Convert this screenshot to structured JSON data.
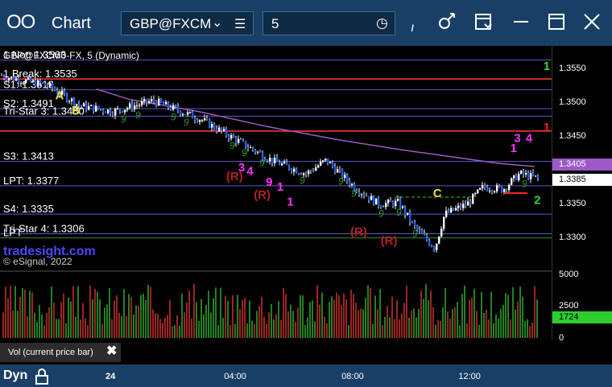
{
  "window": {
    "title": "Chart",
    "symbol": "GBP@FXCM",
    "interval": "5",
    "draw_tool_glyph": "ı"
  },
  "chart_data": {
    "type": "candlestick",
    "symbol_label": "GBP@FXCM0-FX, 5 (Dynamic)",
    "watermark": "tradesight.com",
    "copyright": "© eSignal, 2022",
    "price_axis": {
      "range": [
        1.3265,
        1.3578
      ],
      "ticks": [
        "1.3550",
        "1.3500",
        "1.3450",
        "1.3350",
        "1.3300"
      ],
      "last_price": "1.3385",
      "ma_value": "1.3405",
      "last_price_color": "#ffffff",
      "ma_color": "#9b59c9"
    },
    "time_axis": {
      "labels": [
        {
          "text": "24",
          "at": 0.2
        },
        {
          "text": "04:00",
          "at": 0.415
        },
        {
          "text": "08:00",
          "at": 0.628
        },
        {
          "text": "12:00",
          "at": 0.84
        }
      ]
    },
    "pivot_levels": [
      {
        "label": "1 Not: 1.3563",
        "price": 1.3563,
        "color": "#5a5acc"
      },
      {
        "label": "1 Break: 1.3535",
        "price": 1.3535,
        "color": "#ff3b3b"
      },
      {
        "label": "S1: 1.3519",
        "price": 1.3519,
        "color": "#5a5acc"
      },
      {
        "label": "S2: 1.3491",
        "price": 1.3491,
        "color": "#5a5acc"
      },
      {
        "label": "Tri-Star 3: 1.3480",
        "price": 1.348,
        "color": "#5a5acc"
      },
      {
        "label": "",
        "price": 1.3458,
        "color": "#ff3b3b"
      },
      {
        "label": "S3: 1.3413",
        "price": 1.3413,
        "color": "#5a5acc"
      },
      {
        "label": "LPT: 1.3377",
        "price": 1.3377,
        "color": "#5a5acc"
      },
      {
        "label": "S4: 1.3335",
        "price": 1.3335,
        "color": "#5a5acc"
      },
      {
        "label": "Tri-Star 4: 1.3306",
        "price": 1.3306,
        "color": "#5a5acc"
      },
      {
        "label": "LPT",
        "price": 1.33,
        "color": "#3a8a3a"
      }
    ],
    "annotations": [
      {
        "text": "(R)",
        "at": [
          0.41,
          1.3385
        ],
        "color": "#b22222"
      },
      {
        "text": "(R)",
        "at": [
          0.46,
          1.3358
        ],
        "color": "#b22222"
      },
      {
        "text": "(R)",
        "at": [
          0.635,
          1.3303
        ],
        "color": "#b22222"
      },
      {
        "text": "(R)",
        "at": [
          0.69,
          1.329
        ],
        "color": "#b22222"
      },
      {
        "text": "A",
        "at": [
          0.1,
          1.3505
        ],
        "color": "#e5d84a"
      },
      {
        "text": "B",
        "at": [
          0.13,
          1.3483
        ],
        "color": "#e5d84a"
      },
      {
        "text": "C",
        "at": [
          0.785,
          1.336
        ],
        "color": "#e5d84a"
      },
      {
        "text": "1",
        "at": [
          0.985,
          1.3458
        ],
        "color": "#ff2020"
      },
      {
        "text": "2",
        "at": [
          0.968,
          1.335
        ],
        "color": "#3cd23c"
      },
      {
        "text": "1",
        "at": [
          0.985,
          1.3548
        ],
        "color": "#3cd23c"
      },
      {
        "text": "3",
        "at": [
          0.932,
          1.3442
        ],
        "color": "#ff30ff"
      },
      {
        "text": "4",
        "at": [
          0.953,
          1.3442
        ],
        "color": "#ff30ff"
      },
      {
        "text": "1",
        "at": [
          0.925,
          1.3427
        ],
        "color": "#ff30ff"
      },
      {
        "text": "3",
        "at": [
          0.432,
          1.3398
        ],
        "color": "#ff30ff"
      },
      {
        "text": "4",
        "at": [
          0.447,
          1.3393
        ],
        "color": "#ff30ff"
      },
      {
        "text": "9",
        "at": [
          0.482,
          1.3377
        ],
        "color": "#ff30ff"
      },
      {
        "text": "1",
        "at": [
          0.502,
          1.337
        ],
        "color": "#ff30ff"
      },
      {
        "text": "1",
        "at": [
          0.52,
          1.3348
        ],
        "color": "#ff30ff"
      }
    ],
    "volume": {
      "axis_ticks": [
        "5000",
        "2500",
        "0"
      ],
      "last_value": "1724",
      "last_color": "#2ecc2e",
      "range": [
        0,
        5000
      ],
      "study_label": "Vol (current price bar)"
    }
  },
  "bottom_bar": {
    "mode": "Dyn"
  }
}
